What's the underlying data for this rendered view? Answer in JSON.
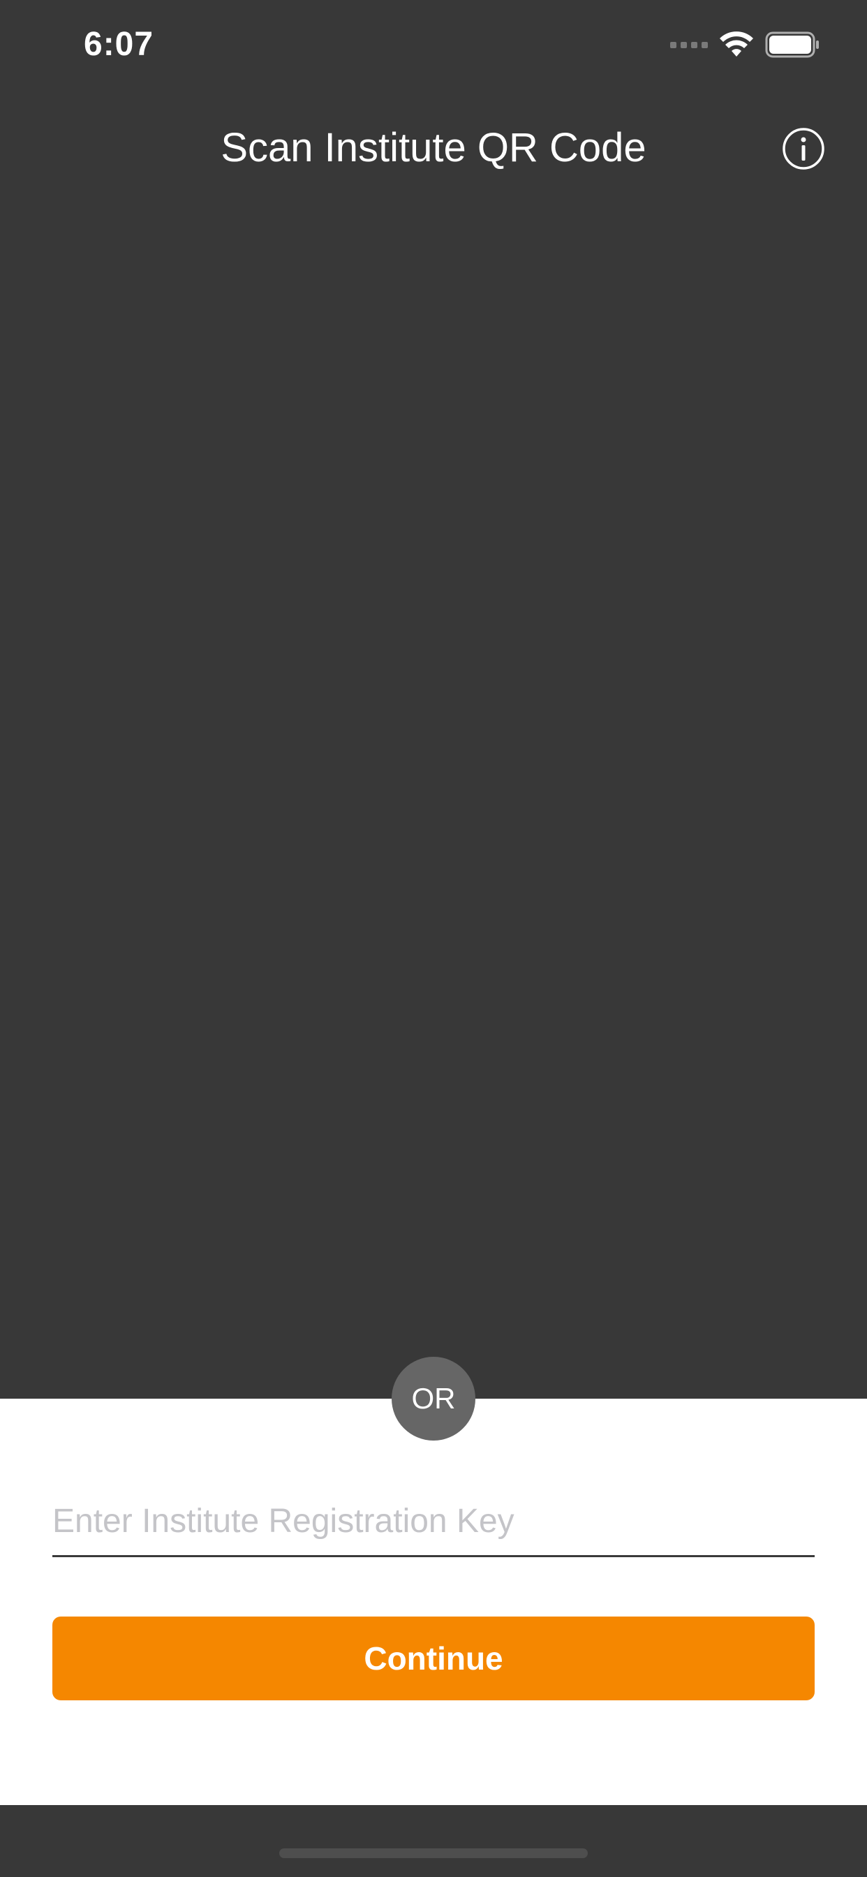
{
  "status_bar": {
    "time": "6:07",
    "icons": [
      "cellular-signal-icon",
      "wifi-icon",
      "battery-icon"
    ]
  },
  "header": {
    "title": "Scan Institute QR Code",
    "info_icon": "info-circle-icon"
  },
  "divider": {
    "or_label": "OR"
  },
  "form": {
    "registration_key_placeholder": "Enter Institute Registration Key",
    "registration_key_value": "",
    "continue_label": "Continue"
  },
  "colors": {
    "background_dark": "#383838",
    "panel_white": "#ffffff",
    "accent_orange": "#f58700",
    "or_badge": "#666666",
    "placeholder_gray": "#c4c4c8"
  }
}
